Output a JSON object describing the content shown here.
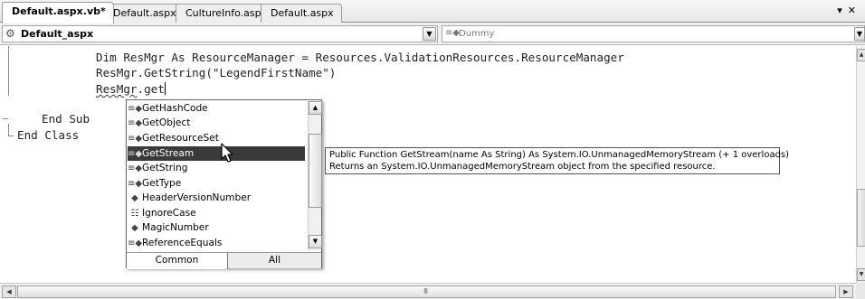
{
  "tabs": [
    {
      "label": "Default.aspx.vb*",
      "active": true
    },
    {
      "label": "Default.aspx",
      "active": false
    },
    {
      "label": "CultureInfo.aspx",
      "active": false
    },
    {
      "label": "Default.aspx",
      "active": false
    }
  ],
  "tabstrip_controls": {
    "dropdown": "▾",
    "close": "✕"
  },
  "navbar": {
    "class_combo": {
      "icon": "class-icon",
      "value": "Default_aspx"
    },
    "member_combo": {
      "icon": "method-icon",
      "value": "Dummy"
    }
  },
  "code": {
    "line1": "Dim ResMgr As ResourceManager = Resources.ValidationResources.ResourceManager",
    "line2": "ResMgr.GetString(\"LegendFirstName\")",
    "line3_object": "ResMgr",
    "line3_suffix": ".get",
    "line4": "End Sub",
    "line5": "End Class"
  },
  "completion": {
    "items": [
      {
        "label": "GetHashCode",
        "icon": "method-icon"
      },
      {
        "label": "GetObject",
        "icon": "method-icon"
      },
      {
        "label": "GetResourceSet",
        "icon": "method-icon"
      },
      {
        "label": "GetStream",
        "icon": "method-icon",
        "selected": true
      },
      {
        "label": "GetString",
        "icon": "method-icon"
      },
      {
        "label": "GetType",
        "icon": "method-icon"
      },
      {
        "label": "HeaderVersionNumber",
        "icon": "field-icon"
      },
      {
        "label": "IgnoreCase",
        "icon": "property-icon"
      },
      {
        "label": "MagicNumber",
        "icon": "field-icon"
      },
      {
        "label": "ReferenceEquals",
        "icon": "method-icon"
      }
    ],
    "tabs": {
      "common": "Common",
      "all": "All"
    }
  },
  "tooltip": {
    "signature": "Public Function GetStream(name As String) As System.IO.UnmanagedMemoryStream (+ 1 overloads)",
    "description": "Returns an System.IO.UnmanagedMemoryStream object from the specified resource."
  },
  "scrollbar_grip": "III"
}
